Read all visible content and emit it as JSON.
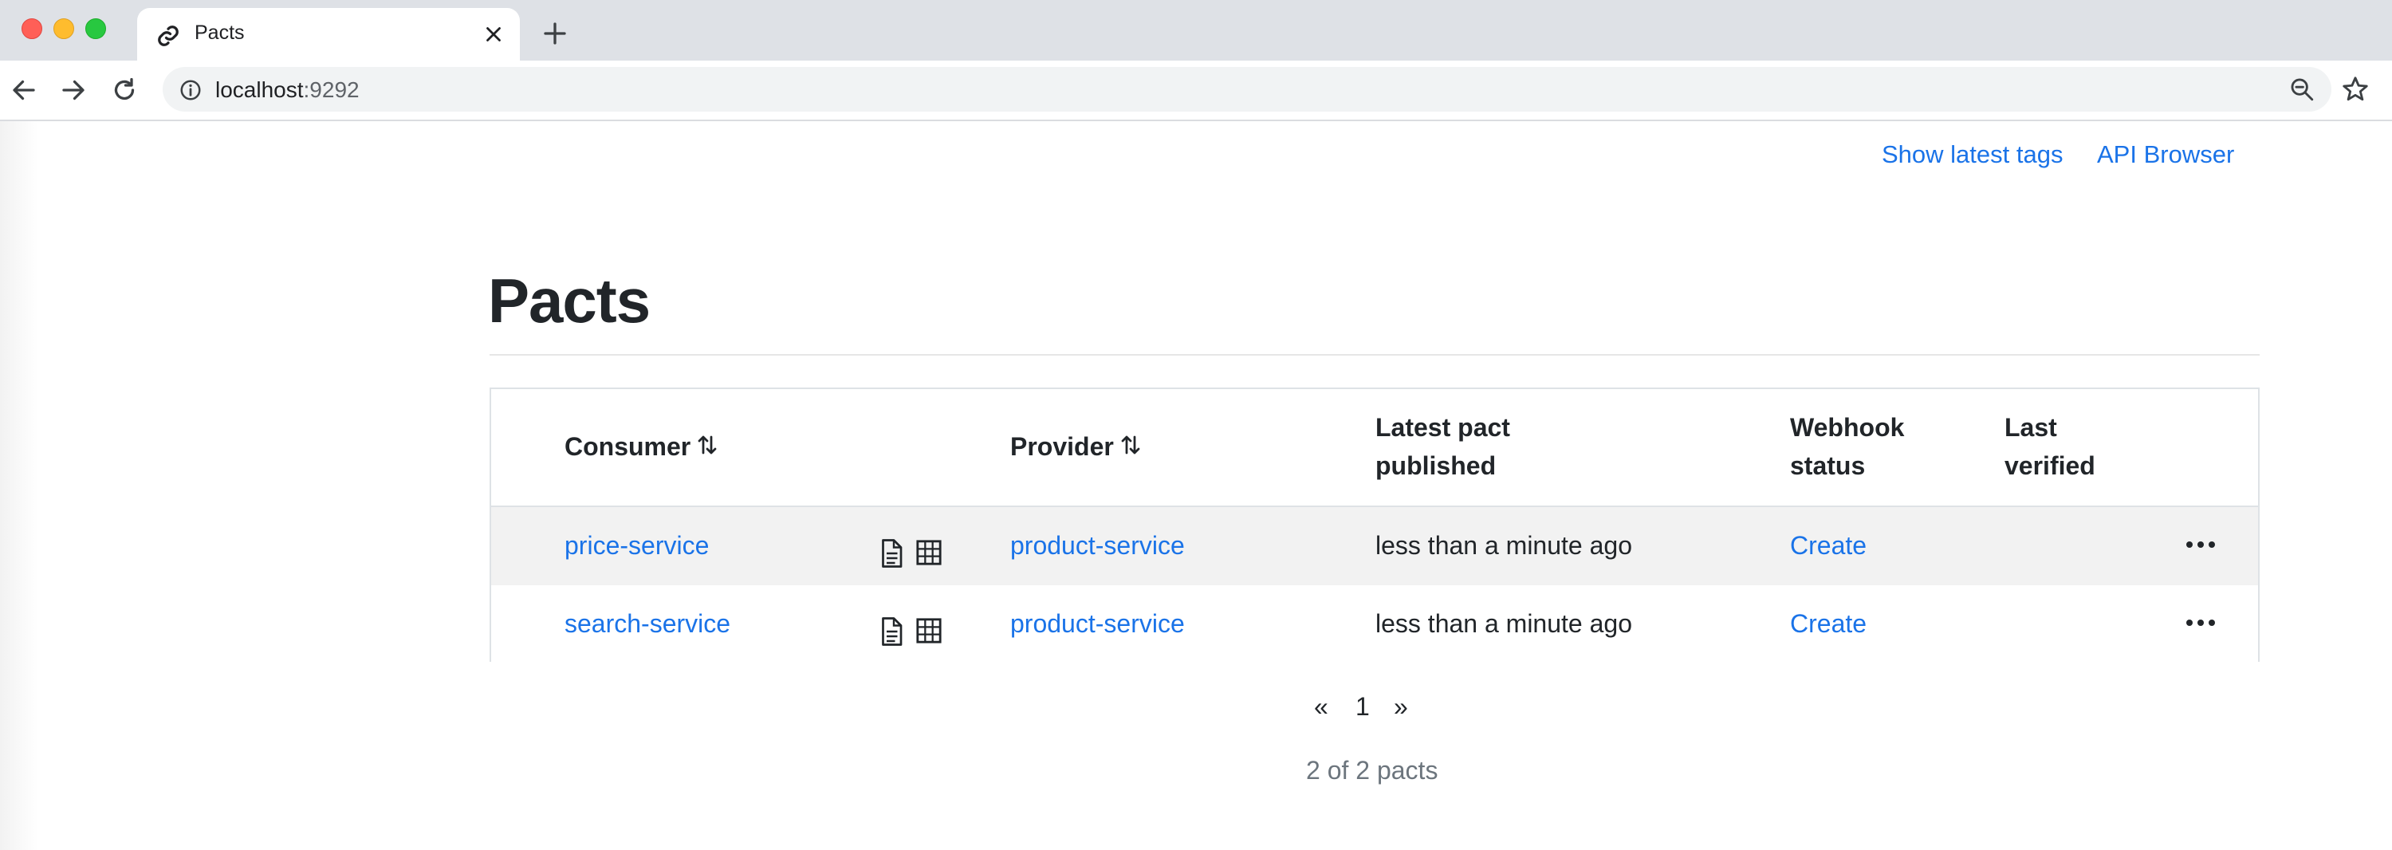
{
  "browser": {
    "tab_title": "Pacts",
    "url_host": "localhost",
    "url_port": ":9292"
  },
  "header": {
    "links": [
      "Show latest tags",
      "API Browser"
    ]
  },
  "page": {
    "title": "Pacts"
  },
  "table": {
    "columns": {
      "consumer": "Consumer",
      "provider": "Provider",
      "latest_pact_line1": "Latest pact",
      "latest_pact_line2": "published",
      "webhook_line1": "Webhook",
      "webhook_line2": "status",
      "last_verified_line1": "Last",
      "last_verified_line2": "verified"
    },
    "rows": [
      {
        "consumer": "price-service",
        "provider": "product-service",
        "published": "less than a minute ago",
        "webhook": "Create",
        "last_verified": ""
      },
      {
        "consumer": "search-service",
        "provider": "product-service",
        "published": "less than a minute ago",
        "webhook": "Create",
        "last_verified": ""
      }
    ]
  },
  "pagination": {
    "prev": "«",
    "current": "1",
    "next": "»",
    "summary": "2 of 2 pacts"
  },
  "icons": {
    "tab": "link-icon",
    "row_actions": [
      "document-icon",
      "grid-icon",
      "more-icon"
    ]
  },
  "colors": {
    "link": "#1a73e8",
    "row_highlight": "#f2f2f2"
  }
}
